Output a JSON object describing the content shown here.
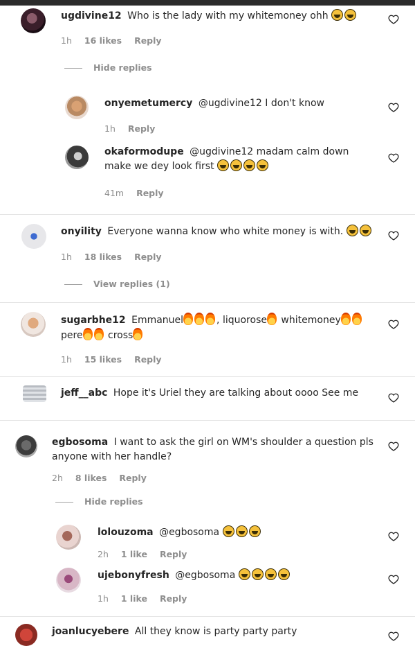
{
  "comments": [
    {
      "id": "c1",
      "user": "ugdivine12",
      "text": "Who is the lady with my whitemoney ohh",
      "emojis": [
        "laugh",
        "scream"
      ],
      "time": "1h",
      "likes": "16 likes",
      "reply": "Reply"
    },
    {
      "id": "c1t",
      "toggle": "Hide replies"
    },
    {
      "id": "r1",
      "user": "onyemetumercy",
      "text": "@ugdivine12 I don't know",
      "time": "1h",
      "reply": "Reply"
    },
    {
      "id": "r2",
      "user": "okaformodupe",
      "text": "@ugdivine12 madam calm down make we dey look first",
      "emojis": [
        "laugh",
        "laugh",
        "laugh",
        "laugh"
      ],
      "time": "41m",
      "reply": "Reply"
    },
    {
      "id": "c2",
      "user": "onyility",
      "text": "Everyone wanna know who white money is with.",
      "emojis": [
        "laugh",
        "laugh"
      ],
      "time": "1h",
      "likes": "18 likes",
      "reply": "Reply"
    },
    {
      "id": "c2t",
      "toggle": "View replies (1)"
    },
    {
      "id": "c3",
      "user": "sugarbhe12",
      "text_parts": [
        "Emmanuel",
        "fire",
        "fire",
        "fire",
        ", liquorose",
        "fire",
        " whitemoney",
        "fire",
        "fire",
        " pere",
        "fire",
        "fire",
        " cross",
        "fire"
      ],
      "time": "1h",
      "likes": "15 likes",
      "reply": "Reply"
    },
    {
      "id": "c4",
      "user": "jeff__abc",
      "text": "Hope it's Uriel they are talking about oooo See me"
    },
    {
      "id": "c5",
      "user": "egbosoma",
      "text": "I want to ask the girl on WM's shoulder a question pls anyone with her handle?",
      "time": "2h",
      "likes": "8 likes",
      "reply": "Reply"
    },
    {
      "id": "c5t",
      "toggle": "Hide replies"
    },
    {
      "id": "r3",
      "user": "lolouzoma",
      "text": "@egbosoma",
      "emojis": [
        "laugh",
        "laugh",
        "laugh"
      ],
      "time": "2h",
      "likes": "1 like",
      "reply": "Reply"
    },
    {
      "id": "r4",
      "user": "ujebonyfresh",
      "text": "@egbosoma",
      "emojis": [
        "laugh",
        "laugh",
        "laugh",
        "laugh"
      ],
      "time": "1h",
      "likes": "1 like",
      "reply": "Reply"
    },
    {
      "id": "c6",
      "user": "joanlucyebere",
      "text": "All they know is party party party"
    }
  ],
  "colors": {
    "text": "#262626",
    "muted": "#8e8e8e",
    "divider": "#e4e4e4"
  },
  "icons": [
    "heart-icon"
  ]
}
